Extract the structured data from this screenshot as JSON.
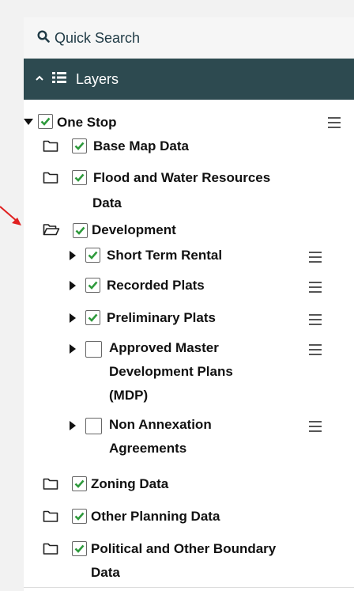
{
  "search": {
    "label": "Quick Search"
  },
  "layers_header": {
    "label": "Layers"
  },
  "tree": {
    "root": {
      "label": "One Stop",
      "checked": true
    },
    "base_map": {
      "label": "Base Map Data",
      "checked": true
    },
    "flood_line1": "Flood and Water Resources",
    "flood_line2": "Data",
    "development": {
      "label": "Development",
      "checked": true
    },
    "short_term_rental": {
      "label": "Short Term Rental",
      "checked": true
    },
    "recorded_plats": {
      "label": "Recorded Plats",
      "checked": true
    },
    "preliminary_plats": {
      "label": "Preliminary Plats",
      "checked": true
    },
    "approved_mdp_line1": "Approved Master",
    "approved_mdp_line2": "Development Plans",
    "approved_mdp_line3": "(MDP)",
    "non_annex_line1": "Non Annexation",
    "non_annex_line2": "Agreements",
    "zoning": {
      "label": "Zoning Data",
      "checked": true
    },
    "other_planning": {
      "label": "Other Planning Data",
      "checked": true
    },
    "political_line1": "Political and Other Boundary",
    "political_line2": "Data"
  },
  "colors": {
    "header_bg": "#2d4a50",
    "check": "#2e9a3c",
    "annotation_arrow": "#e02020"
  }
}
